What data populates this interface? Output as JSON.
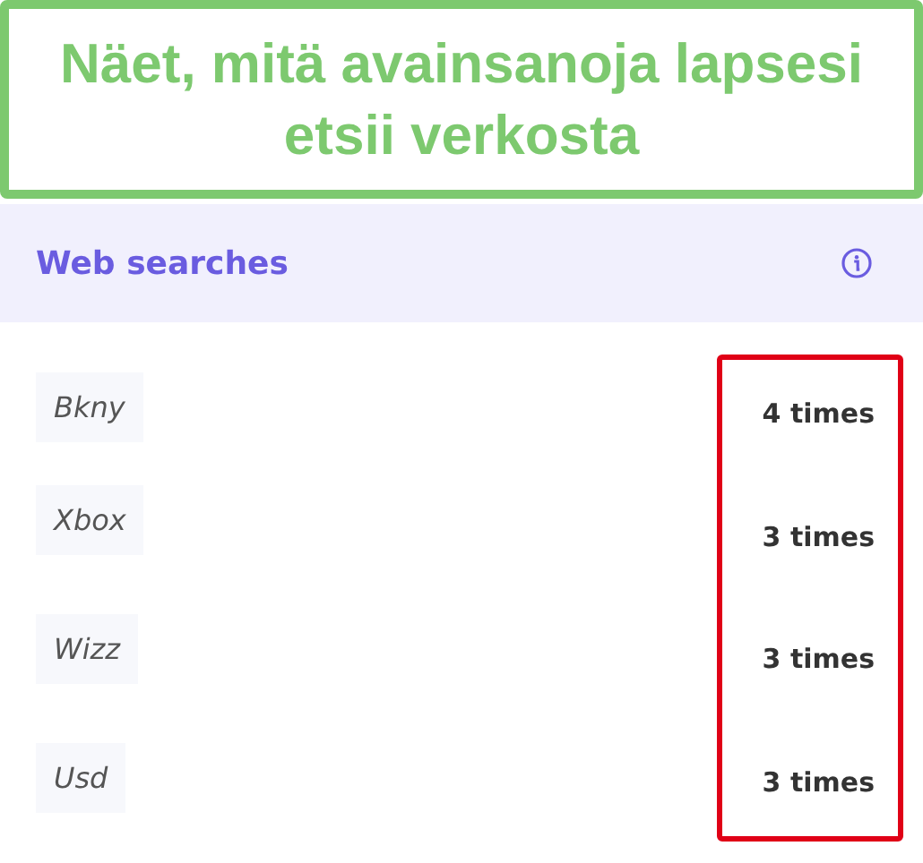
{
  "caption": "Näet, mitä avainsanoja lapsesi etsii verkosta",
  "panel": {
    "title": "Web searches"
  },
  "searches": [
    {
      "term": "Bkny",
      "count": "4 times"
    },
    {
      "term": "Xbox",
      "count": "3 times"
    },
    {
      "term": "Wizz",
      "count": "3 times"
    },
    {
      "term": "Usd",
      "count": "3 times"
    }
  ]
}
